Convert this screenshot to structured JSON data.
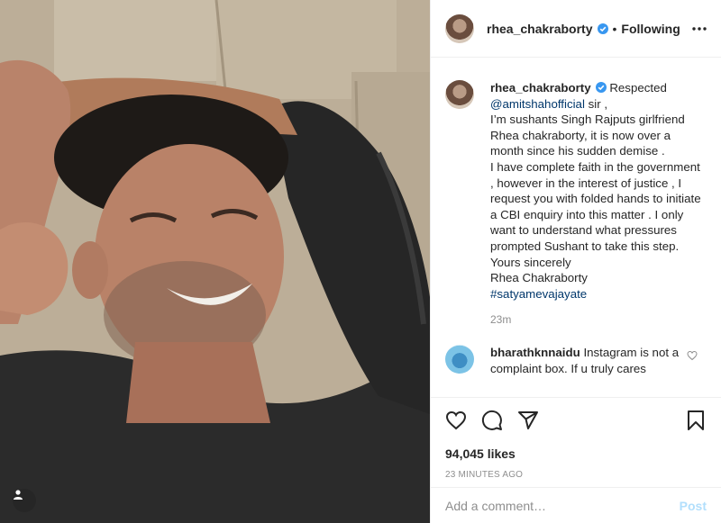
{
  "post": {
    "author": "rhea_chakraborty",
    "follow_separator": "•",
    "follow_status": "Following",
    "more_icon": "more-horizontal-icon",
    "verified_color": "#3897f0"
  },
  "caption": {
    "author": "rhea_chakraborty",
    "first_word": "Respected",
    "mention": "@amitshahofficial",
    "after_mention": "sir ,",
    "lines": [
      "I’m sushants Singh Rajputs girlfriend Rhea chakraborty, it is now over a month since his sudden demise .",
      "I have complete faith in the government , however in the interest of justice , I request you with folded hands to initiate a CBI enquiry into this matter . I only want to understand what pressures prompted Sushant to take this step.",
      "Yours sincerely",
      "Rhea Chakraborty"
    ],
    "hashtag": "#satyamevajayate",
    "time": "23m"
  },
  "top_comment": {
    "author": "bharathknnaidu",
    "text": "Instagram is not a complaint box. If u truly cares"
  },
  "actions": {
    "icons": [
      "heart-icon",
      "comment-icon",
      "share-icon",
      "bookmark-icon"
    ],
    "likes": "94,045 likes",
    "posted": "23 MINUTES AGO"
  },
  "compose": {
    "placeholder": "Add a comment…",
    "post_label": "Post",
    "post_color": "#b2dffc"
  }
}
